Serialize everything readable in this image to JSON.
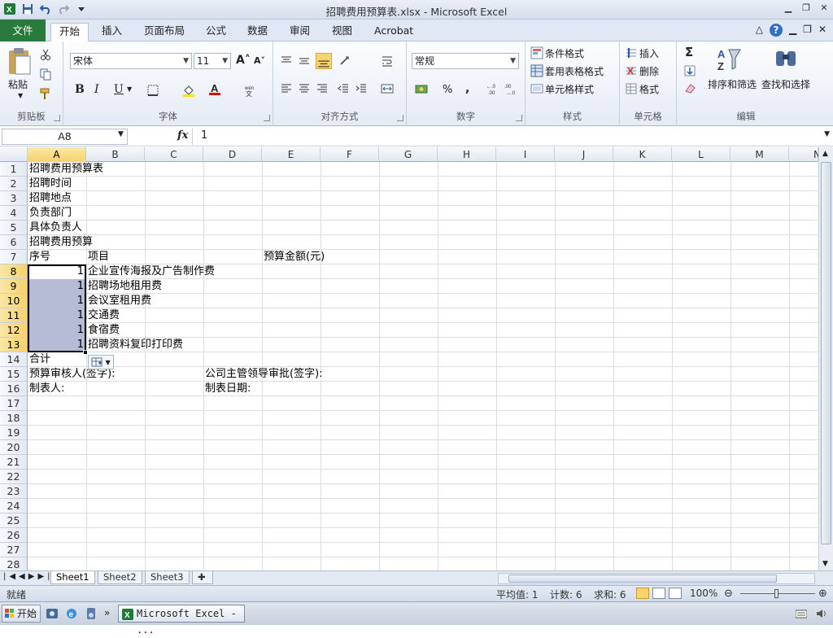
{
  "window": {
    "title": "招聘费用预算表.xlsx - Microsoft Excel"
  },
  "tabs": [
    {
      "label": "文件"
    },
    {
      "label": "开始"
    },
    {
      "label": "插入"
    },
    {
      "label": "页面布局"
    },
    {
      "label": "公式"
    },
    {
      "label": "数据"
    },
    {
      "label": "审阅"
    },
    {
      "label": "视图"
    },
    {
      "label": "Acrobat"
    }
  ],
  "ribbon": {
    "clipboard": {
      "label": "剪贴板",
      "paste": "粘贴"
    },
    "font": {
      "label": "字体",
      "font_name": "宋体",
      "font_size": "11",
      "bold": "B",
      "italic": "I",
      "underline": "U"
    },
    "alignment": {
      "label": "对齐方式"
    },
    "number": {
      "label": "数字",
      "format": "常规",
      "percent": "%",
      "comma": ",",
      "inc_dec": "+.0\n.00",
      "dec_dec": ".00\n+.0"
    },
    "styles": {
      "label": "样式",
      "conditional": "条件格式",
      "table": "套用表格格式",
      "cell_styles": "单元格样式"
    },
    "cells": {
      "label": "单元格",
      "insert": "插入",
      "delete": "删除",
      "format": "格式"
    },
    "editing": {
      "label": "编辑",
      "sort_filter": "排序和筛选",
      "find_select": "查找和选择",
      "sigma": "Σ"
    }
  },
  "formula_bar": {
    "name_box": "A8",
    "fx": "fx",
    "value": "1"
  },
  "columns": [
    "A",
    "B",
    "C",
    "D",
    "E",
    "F",
    "G",
    "H",
    "I",
    "J",
    "K",
    "L",
    "M",
    "N"
  ],
  "rows": [
    "1",
    "2",
    "3",
    "4",
    "5",
    "6",
    "7",
    "8",
    "9",
    "10",
    "11",
    "12",
    "13",
    "14",
    "15",
    "16",
    "17",
    "18",
    "19",
    "20",
    "21",
    "22",
    "23",
    "24",
    "25",
    "26",
    "27",
    "28"
  ],
  "cells": {
    "r1a": "招聘费用预算表",
    "r2a": "招聘时间",
    "r3a": "招聘地点",
    "r4a": "负责部门",
    "r5a": "具体负责人",
    "r6a": "招聘费用预算",
    "r7a": "序号",
    "r7b": "项目",
    "r7e": "预算金额(元)",
    "r8a": "1",
    "r8b": "企业宣传海报及广告制作费",
    "r9a": "1",
    "r9b": "招聘场地租用费",
    "r10a": "1",
    "r10b": "会议室租用费",
    "r11a": "1",
    "r11b": "交通费",
    "r12a": "1",
    "r12b": "食宿费",
    "r13a": "1",
    "r13b": "招聘资料复印打印费",
    "r14a": "合计",
    "r15a": "预算审核人(签字):",
    "r15d": "公司主管领导审批(签字):",
    "r16a": "制表人:",
    "r16d": "制表日期:"
  },
  "sheets": [
    {
      "name": "Sheet1"
    },
    {
      "name": "Sheet2"
    },
    {
      "name": "Sheet3"
    }
  ],
  "status": {
    "ready": "就绪",
    "average": "平均值: 1",
    "count": "计数: 6",
    "sum": "求和: 6",
    "zoom": "100%"
  },
  "taskbar": {
    "start": "开始",
    "item": "Microsoft Excel - ..."
  }
}
